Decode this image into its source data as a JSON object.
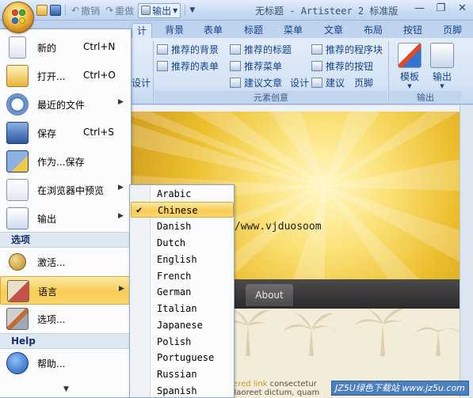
{
  "window": {
    "title": "无标题",
    "title_app": " - Artisteer 2 标准版",
    "controls": [
      "—",
      "❐",
      "✕"
    ]
  },
  "qat": {
    "undo_label": "撤销",
    "redo_label": "重做",
    "export_label": "输出"
  },
  "tabs": [
    "计",
    "背景",
    "表单",
    "标题",
    "菜单",
    "文章",
    "布局",
    "按钮",
    "页脚"
  ],
  "ribbon": {
    "items": [
      {
        "label": "推荐的背景"
      },
      {
        "label": "推荐的表单"
      },
      {
        "label": "推荐的标题"
      },
      {
        "label": "推荐菜单"
      },
      {
        "label": "建议文章"
      },
      {
        "label": "设计"
      },
      {
        "label": "推荐的程序块"
      },
      {
        "label": "推荐的按钮"
      },
      {
        "label": "建议"
      },
      {
        "label": "页脚"
      }
    ],
    "left_cut_label": "设计",
    "group_title": "元素创意",
    "export_group_title": "输出",
    "template_label": "模板",
    "export_label": "输出"
  },
  "preview": {
    "nav_button": "About",
    "content_text_link": "overed link",
    "content_text_1": " consectetur",
    "content_text_2": "er laoreet dictum, quam "
  },
  "watermarks": {
    "url": "http://www.vjduosoom",
    "site": "JZ5U绿色下载站 www.jz5u.com"
  },
  "app_menu": {
    "items": [
      {
        "label": "新的",
        "shortcut": "Ctrl+N",
        "icon": "new-document-icon"
      },
      {
        "label": "打开...",
        "shortcut": "Ctrl+O",
        "icon": "open-folder-icon"
      },
      {
        "label": "最近的文件",
        "shortcut": "",
        "icon": "recent-files-icon",
        "submenu": true
      },
      {
        "label": "保存",
        "shortcut": "Ctrl+S",
        "icon": "save-disk-icon"
      },
      {
        "label": "作为...保存",
        "shortcut": "",
        "icon": "save-as-icon"
      },
      {
        "label": "在浏览器中预览",
        "shortcut": "",
        "icon": "preview-browser-icon",
        "submenu": true
      },
      {
        "label": "输出",
        "shortcut": "",
        "icon": "export-icon",
        "submenu": true
      }
    ],
    "section_options": "选项",
    "options_items": [
      {
        "label": "激活...",
        "icon": "key-icon"
      },
      {
        "label": "语言",
        "icon": "language-icon",
        "submenu": true,
        "highlighted": true
      },
      {
        "label": "选项...",
        "icon": "tools-icon"
      }
    ],
    "section_help": "Help",
    "help_items": [
      {
        "label": "帮助...",
        "icon": "help-icon"
      }
    ]
  },
  "language_menu": {
    "selected": "Chinese",
    "options": [
      "Arabic",
      "Chinese",
      "Danish",
      "Dutch",
      "English",
      "French",
      "German",
      "Italian",
      "Japanese",
      "Polish",
      "Portuguese",
      "Russian",
      "Spanish"
    ]
  },
  "colors": {
    "ribbon_blue": "#c4d8f0",
    "highlight": "#f8cc56",
    "banner": "#ecbe2d",
    "navbar": "#2a2a2a"
  }
}
